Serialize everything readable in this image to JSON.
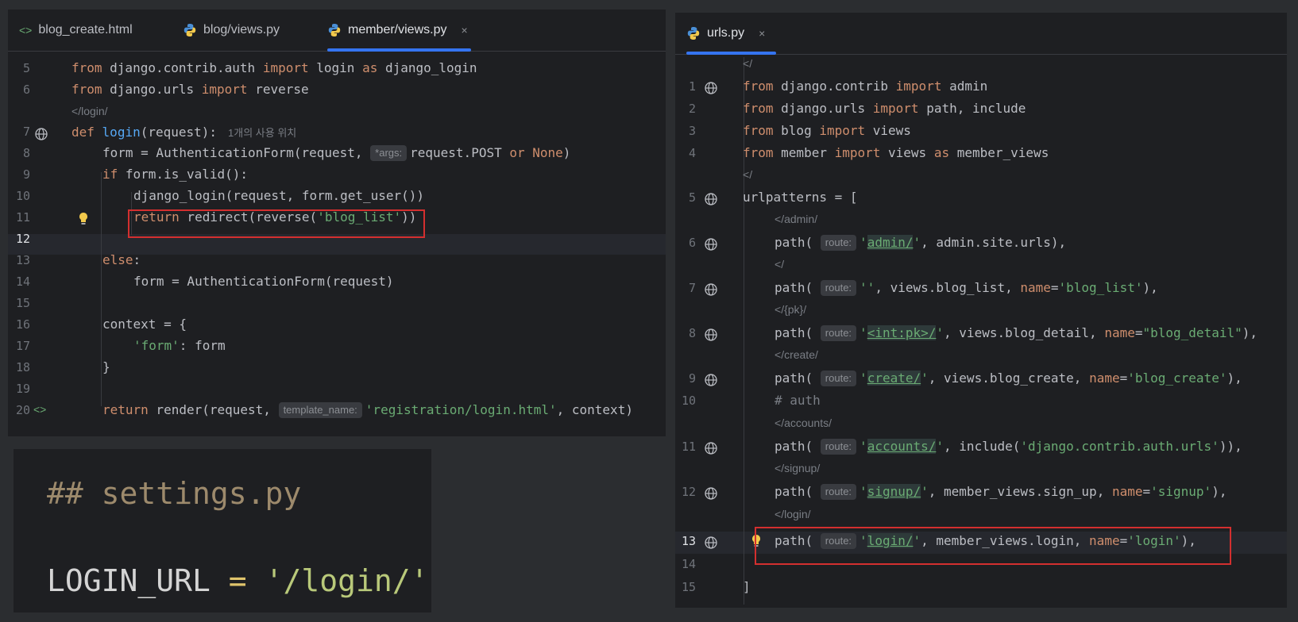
{
  "left_editor": {
    "tabs": [
      {
        "label": "blog_create.html",
        "icon": "html-icon",
        "active": false
      },
      {
        "label": "blog/views.py",
        "icon": "python-icon",
        "active": false
      },
      {
        "label": "member/views.py",
        "icon": "python-icon",
        "active": true,
        "close": "×"
      }
    ],
    "line_numbers": [
      "5",
      "6",
      "7",
      "8",
      "9",
      "10",
      "11",
      "12",
      "13",
      "14",
      "15",
      "16",
      "17",
      "18",
      "19",
      "20"
    ],
    "route_hint": "/login/",
    "usage_hint": "1개의 사용 위치",
    "inlay_args": "*args:",
    "inlay_template": "template_name:"
  },
  "right_editor": {
    "tabs": [
      {
        "label": "urls.py",
        "icon": "python-icon",
        "active": true,
        "close": "×"
      }
    ],
    "line_numbers": [
      "1",
      "2",
      "3",
      "4",
      "5",
      "6",
      "7",
      "8",
      "9",
      "10",
      "11",
      "12",
      "13",
      "14",
      "15"
    ],
    "hints": [
      "/",
      "/",
      "/admin/",
      "/",
      "/{pk}/",
      "/create/",
      "/accounts/",
      "/signup/",
      "/login/"
    ],
    "inlay_route": "route:"
  },
  "settings_snippet": {
    "comment": "## settings.py",
    "name": "LOGIN_URL",
    "eq": "=",
    "value": "'/login/'"
  },
  "colors": {
    "keyword": "#cf8e6d",
    "function": "#56a8f5",
    "string": "#6aab73",
    "highlight_box": "#d32f2f",
    "tab_accent": "#3574f0"
  }
}
